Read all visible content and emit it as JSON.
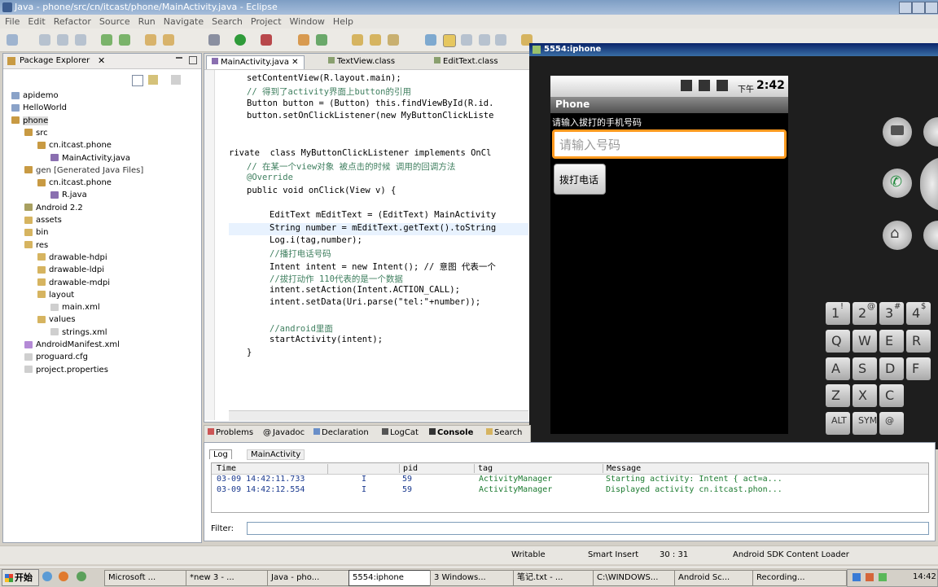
{
  "window": {
    "title": "Java - phone/src/cn/itcast/phone/MainActivity.java - Eclipse"
  },
  "menu": [
    "File",
    "Edit",
    "Refactor",
    "Source",
    "Run",
    "Navigate",
    "Search",
    "Project",
    "Window",
    "Help"
  ],
  "package_explorer": {
    "title": "Package Explorer",
    "tree": [
      {
        "label": "apidemo",
        "depth": 0
      },
      {
        "label": "HelloWorld",
        "depth": 0
      },
      {
        "label": "phone",
        "depth": 0
      },
      {
        "label": "src",
        "depth": 1
      },
      {
        "label": "cn.itcast.phone",
        "depth": 2
      },
      {
        "label": "MainActivity.java",
        "depth": 3
      },
      {
        "label": "gen [Generated Java Files]",
        "depth": 1
      },
      {
        "label": "cn.itcast.phone",
        "depth": 2
      },
      {
        "label": "R.java",
        "depth": 3
      },
      {
        "label": "Android 2.2",
        "depth": 1
      },
      {
        "label": "assets",
        "depth": 1
      },
      {
        "label": "bin",
        "depth": 1
      },
      {
        "label": "res",
        "depth": 1
      },
      {
        "label": "drawable-hdpi",
        "depth": 2
      },
      {
        "label": "drawable-ldpi",
        "depth": 2
      },
      {
        "label": "drawable-mdpi",
        "depth": 2
      },
      {
        "label": "layout",
        "depth": 2
      },
      {
        "label": "main.xml",
        "depth": 3
      },
      {
        "label": "values",
        "depth": 2
      },
      {
        "label": "strings.xml",
        "depth": 3
      },
      {
        "label": "AndroidManifest.xml",
        "depth": 1
      },
      {
        "label": "proguard.cfg",
        "depth": 1
      },
      {
        "label": "project.properties",
        "depth": 1
      }
    ]
  },
  "editor": {
    "tabs": [
      "MainActivity.java",
      "TextView.class",
      "EditText.class"
    ],
    "lines": [
      "setContentView(R.layout.main);",
      "// 得到了activity界面上button的引用",
      "Button button = (Button) this.findViewById(R.id.",
      "button.setOnClickListener(new MyButtonClickListe",
      "",
      "",
      "rivate  class MyButtonClickListener implements OnCl",
      "// 在某一个view对象 被点击的时候 调用的回调方法",
      "@Override",
      "public void onClick(View v) {",
      "",
      "EditText mEditText = (EditText) MainActivity",
      "String number = mEditText.getText().toString",
      "Log.i(tag,number);",
      "//播打电话号码",
      "Intent intent = new Intent(); // 意图 代表一个",
      "//拔打动作 110代表的是一个数据",
      "intent.setAction(Intent.ACTION_CALL);",
      "intent.setData(Uri.parse(\"tel:\"+number));",
      "",
      "//android里面",
      "startActivity(intent);",
      "}"
    ]
  },
  "bottom_tabs": [
    "Problems",
    "Javadoc",
    "Declaration",
    "LogCat",
    "Console",
    "Search"
  ],
  "logcat": {
    "subtabs": [
      "Log",
      "MainActivity"
    ],
    "columns": [
      "Time",
      "",
      "pid",
      "tag",
      "Message"
    ],
    "rows": [
      [
        "03-09 14:42:11.733",
        "I",
        "59",
        "ActivityManager",
        "Starting activity: Intent { act=a..."
      ],
      [
        "03-09 14:42:12.554",
        "I",
        "59",
        "ActivityManager",
        "Displayed activity cn.itcast.phon..."
      ]
    ],
    "filter_label": "Filter:"
  },
  "status": {
    "writable": "Writable",
    "insert": "Smart Insert",
    "position": "30 : 31",
    "loader": "Android SDK Content Loader"
  },
  "emulator": {
    "title": "5554:iphone",
    "status_time": "2:42",
    "status_ampm": "下午",
    "app_title": "Phone",
    "prompt": "请输入拔打的手机号码",
    "input_placeholder": "请输入号码",
    "call_button": "拨打电话",
    "keys_row1": [
      "1",
      "2",
      "3",
      "4"
    ],
    "keys_row1_alt": [
      "!",
      "@",
      "#",
      "$"
    ],
    "keys_row2": [
      "Q",
      "W",
      "E",
      "R"
    ],
    "keys_row3": [
      "A",
      "S",
      "D",
      "F"
    ],
    "keys_row4": [
      "Z",
      "X",
      "C"
    ],
    "keys_row5": [
      "ALT",
      "SYM",
      "@"
    ]
  },
  "taskbar": {
    "start": "开始",
    "tasks": [
      "Microsoft ...",
      "*new 3 - ...",
      "Java - pho...",
      "5554:iphone",
      "3 Windows...",
      "笔记.txt - ...",
      "C:\\WINDOWS...",
      "Android Sc...",
      "Recording..."
    ],
    "clock": "14:42"
  }
}
